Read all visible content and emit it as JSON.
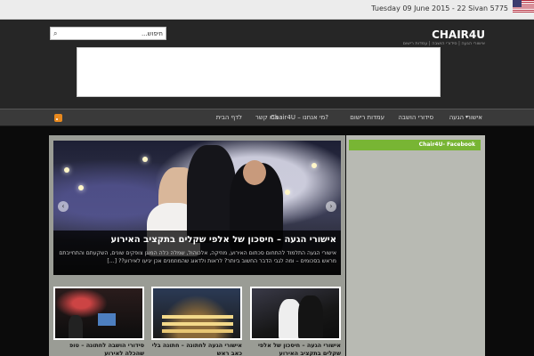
{
  "topbar": {
    "date": "Tuesday 09 June 2015 - 22 Sivan 5775",
    "flag_icon": "us-flag-icon"
  },
  "header": {
    "site_title": "CHAIR4U",
    "tagline": "אישורי הגעה | סידורי הושבה | עמדות רישום",
    "search": {
      "placeholder": "חיפוש...",
      "value": ""
    }
  },
  "nav": {
    "items": [
      {
        "label": "אישורי הגעה"
      },
      {
        "label": "סידורי הושבה"
      },
      {
        "label": "עמדות רישום"
      },
      {
        "label": "Chair4U – מי אנחנו?"
      },
      {
        "label": "צרו קשר"
      },
      {
        "label": "לדף הבית"
      }
    ],
    "rss_icon": "rss-icon"
  },
  "slider": {
    "title": "אישורי הגעה – חיסכון של אלפי שקלים בתקציב האירוע",
    "text": "אישורי הגעה התלמוד להתחום סכתום האירוע, מוזיקה, אלכוהול, שמלה כלה המוגן צופקים שונים, השקעתם והתחייבתם מראש בסכומים – ומה לגבי הדבר החשוב ביותר? לראות ולדאוג שהמוזמנים אכן יגיעו לאירוע?? [...]"
  },
  "sidebar": {
    "widget_title": "Chair4U- Facebook"
  },
  "thumbnails": [
    {
      "title": "אישורי הגעה – חיסכון של אלפי שקלים בתקציב האירוע"
    },
    {
      "title": "אישורי הגעה לחתונה – חתונה בלי כאב ראש"
    },
    {
      "title": "סידורי הושבה לחתונה – טופ שהכלה לאירוע"
    }
  ],
  "colors": {
    "accent_green": "#78b534",
    "nav_bg": "#3a3a3a",
    "header_bg": "#262626"
  }
}
